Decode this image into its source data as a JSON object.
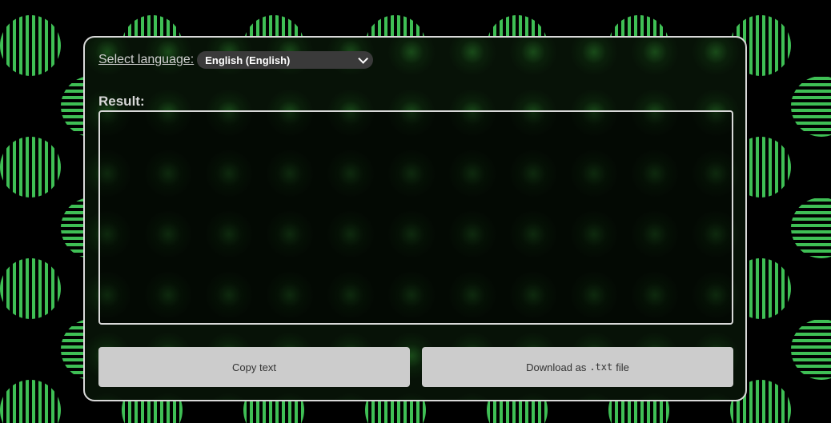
{
  "language": {
    "label": "Select language:",
    "selected": "English (English)"
  },
  "result": {
    "label": "Result:",
    "text": ""
  },
  "buttons": {
    "copy": "Copy text",
    "download_prefix": "Download as",
    "download_ext": ".txt",
    "download_suffix": "file"
  },
  "colors": {
    "stripe_green": "#3fbf55",
    "background": "#000000",
    "panel_border": "#d9d9d9",
    "button_bg": "#cccccc"
  }
}
